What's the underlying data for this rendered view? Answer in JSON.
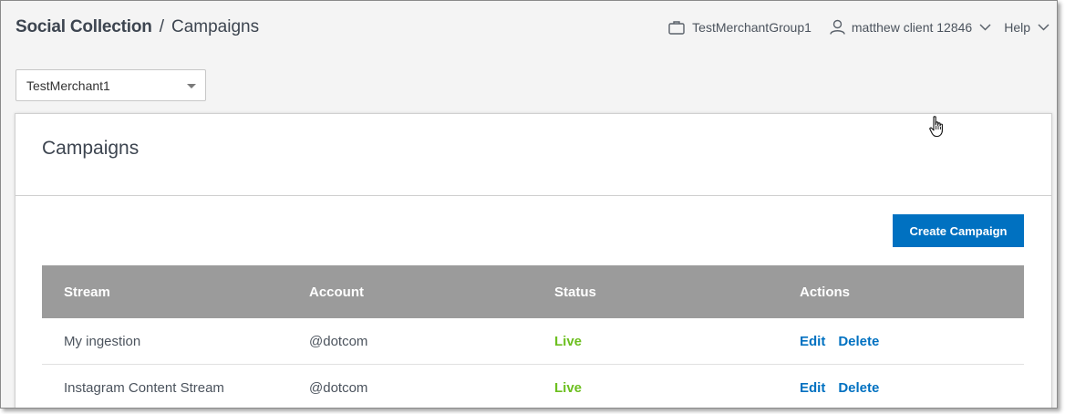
{
  "header": {
    "app_name": "Social Collection",
    "separator": "/",
    "page_name": "Campaigns",
    "merchant_group": "TestMerchantGroup1",
    "user_name": "matthew client 12846",
    "help_label": "Help"
  },
  "merchant_select": {
    "value": "TestMerchant1"
  },
  "panel": {
    "title": "Campaigns",
    "create_button_label": "Create Campaign"
  },
  "table": {
    "columns": [
      "Stream",
      "Account",
      "Status",
      "Actions"
    ],
    "rows": [
      {
        "stream": "My ingestion",
        "account": "@dotcom",
        "status": "Live",
        "edit": "Edit",
        "delete": "Delete"
      },
      {
        "stream": "Instagram Content Stream",
        "account": "@dotcom",
        "status": "Live",
        "edit": "Edit",
        "delete": "Delete"
      }
    ]
  },
  "colors": {
    "accent": "#0071c1",
    "status_live": "#6cbf1f",
    "table_header": "#9b9b9b",
    "background": "#f4f4f4"
  },
  "icons": {
    "merchant_group": "briefcase-icon",
    "user": "user-icon",
    "chevron": "chevron-down-icon",
    "select_caret": "caret-down-icon",
    "cursor": "hand-pointer-cursor"
  }
}
